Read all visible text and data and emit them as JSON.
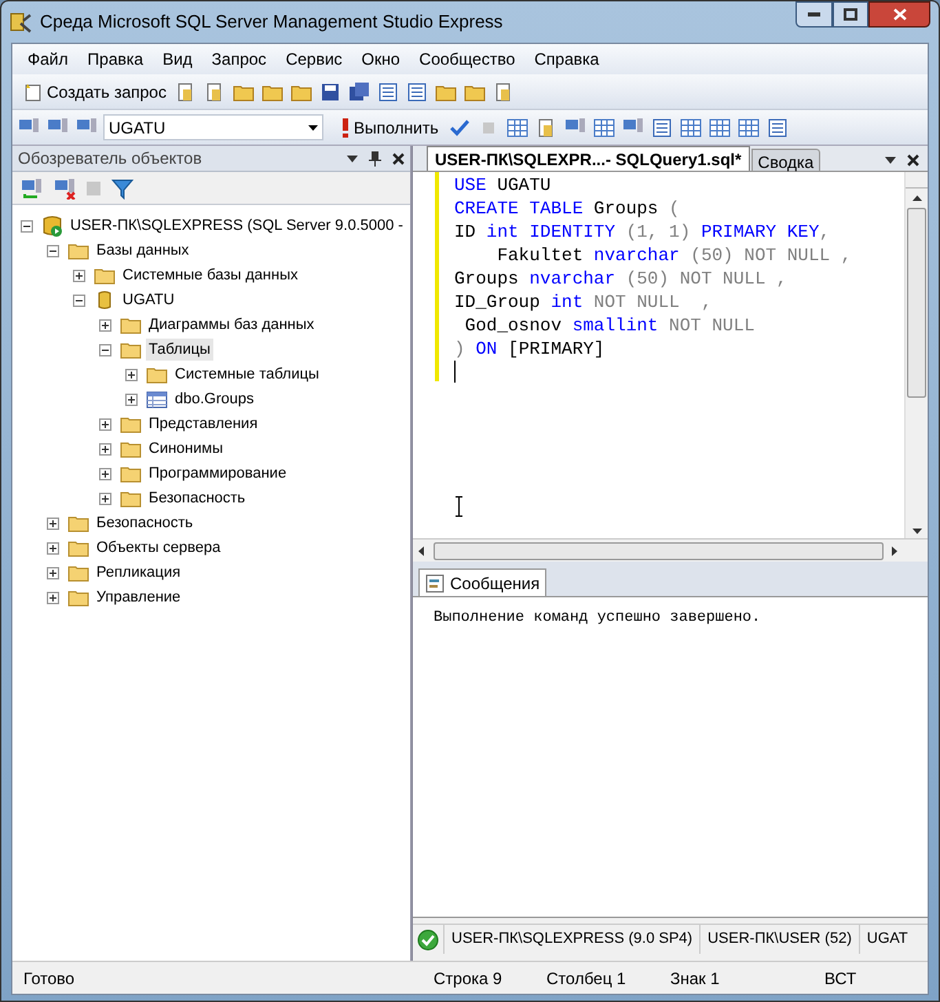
{
  "window": {
    "title": "Среда Microsoft SQL Server Management Studio Express"
  },
  "menu": [
    "Файл",
    "Правка",
    "Вид",
    "Запрос",
    "Сервис",
    "Окно",
    "Сообщество",
    "Справка"
  ],
  "toolbar": {
    "new_query": "Создать запрос",
    "database": "UGATU",
    "execute": "Выполнить"
  },
  "object_explorer": {
    "title": "Обозреватель объектов",
    "tree": [
      {
        "label": "USER-ПК\\SQLEXPRESS (SQL Server 9.0.5000 -",
        "kind": "server",
        "expanded": true,
        "selected": false,
        "children": [
          {
            "label": "Базы данных",
            "kind": "folder",
            "expanded": true,
            "selected": false,
            "children": [
              {
                "label": "Системные базы данных",
                "kind": "folder",
                "expanded": false,
                "selected": false
              },
              {
                "label": "UGATU",
                "kind": "database",
                "expanded": true,
                "selected": false,
                "children": [
                  {
                    "label": "Диаграммы баз данных",
                    "kind": "folder",
                    "expanded": false,
                    "selected": false
                  },
                  {
                    "label": "Таблицы",
                    "kind": "folder",
                    "expanded": true,
                    "selected": true,
                    "children": [
                      {
                        "label": "Системные таблицы",
                        "kind": "folder",
                        "expanded": false,
                        "selected": false
                      },
                      {
                        "label": "dbo.Groups",
                        "kind": "table",
                        "expanded": false,
                        "selected": false
                      }
                    ]
                  },
                  {
                    "label": "Представления",
                    "kind": "folder",
                    "expanded": false,
                    "selected": false
                  },
                  {
                    "label": "Синонимы",
                    "kind": "folder",
                    "expanded": false,
                    "selected": false
                  },
                  {
                    "label": "Программирование",
                    "kind": "folder",
                    "expanded": false,
                    "selected": false
                  },
                  {
                    "label": "Безопасность",
                    "kind": "folder",
                    "expanded": false,
                    "selected": false
                  }
                ]
              }
            ]
          },
          {
            "label": "Безопасность",
            "kind": "folder",
            "expanded": false,
            "selected": false
          },
          {
            "label": "Объекты сервера",
            "kind": "folder",
            "expanded": false,
            "selected": false
          },
          {
            "label": "Репликация",
            "kind": "folder",
            "expanded": false,
            "selected": false
          },
          {
            "label": "Управление",
            "kind": "folder",
            "expanded": false,
            "selected": false
          }
        ]
      }
    ]
  },
  "editor_tabs": [
    {
      "label": "USER-ПК\\SQLEXPR...- SQLQuery1.sql*",
      "selected": true
    },
    {
      "label": "Сводка",
      "selected": false
    }
  ],
  "code": [
    [
      {
        "text": "USE",
        "kind": "keyword"
      },
      {
        "text": " UGATU",
        "kind": "plain"
      }
    ],
    [
      {
        "text": "CREATE",
        "kind": "keyword"
      },
      {
        "text": " TABLE",
        "kind": "keyword"
      },
      {
        "text": " Groups ",
        "kind": "plain"
      },
      {
        "text": "(",
        "kind": "operator"
      }
    ],
    [
      {
        "text": "ID ",
        "kind": "plain"
      },
      {
        "text": "int",
        "kind": "keyword"
      },
      {
        "text": " IDENTITY",
        "kind": "keyword"
      },
      {
        "text": " (1, 1) ",
        "kind": "operator"
      },
      {
        "text": "PRIMARY KEY",
        "kind": "keyword"
      },
      {
        "text": ",",
        "kind": "operator"
      }
    ],
    [
      {
        "text": "    Fakultet ",
        "kind": "plain"
      },
      {
        "text": "nvarchar",
        "kind": "keyword"
      },
      {
        "text": " (50) NOT NULL ,",
        "kind": "operator"
      }
    ],
    [
      {
        "text": "Groups ",
        "kind": "plain"
      },
      {
        "text": "nvarchar",
        "kind": "keyword"
      },
      {
        "text": " (50) NOT NULL ,",
        "kind": "operator"
      }
    ],
    [
      {
        "text": "ID_Group ",
        "kind": "plain"
      },
      {
        "text": "int",
        "kind": "keyword"
      },
      {
        "text": " NOT NULL  ,",
        "kind": "operator"
      }
    ],
    [
      {
        "text": " God_osnov ",
        "kind": "plain"
      },
      {
        "text": "smallint",
        "kind": "keyword"
      },
      {
        "text": " NOT NULL",
        "kind": "operator"
      }
    ],
    [
      {
        "text": ")",
        "kind": "operator"
      },
      {
        "text": " ON",
        "kind": "keyword"
      },
      {
        "text": " [PRIMARY]",
        "kind": "plain"
      }
    ]
  ],
  "results": {
    "tab": "Сообщения",
    "message": "Выполнение команд успешно завершено."
  },
  "connection_bar": [
    "USER-ПК\\SQLEXPRESS (9.0 SP4)",
    "USER-ПК\\USER (52)",
    "UGAT"
  ],
  "status_bar": {
    "state": "Готово",
    "line": "Строка 9",
    "column": "Столбец 1",
    "char": "Знак 1",
    "mode": "ВСТ"
  }
}
